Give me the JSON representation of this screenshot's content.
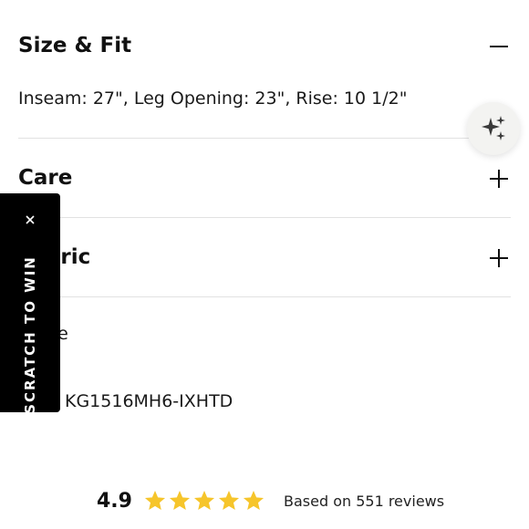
{
  "sections": {
    "size_fit": {
      "title": "Size & Fit",
      "details": "Inseam: 27\", Leg Opening: 23\", Rise: 10 1/2\""
    },
    "care": {
      "title": "Care"
    },
    "fabric": {
      "title": "Fabric"
    }
  },
  "share": {
    "label": "Share"
  },
  "sku": {
    "value": "KG1516MH6-IXHTD"
  },
  "scratch_tab": {
    "label": "SCRATCH TO WIN"
  },
  "reviews": {
    "rating": "4.9",
    "stars": 5,
    "summary": "Based on 551 reviews"
  },
  "colors": {
    "star": "#F6C52B",
    "tab_bg": "#000000",
    "text": "#111111"
  },
  "icons": [
    "minus-icon",
    "plus-icon",
    "sparkles-icon",
    "close-icon",
    "star-icon"
  ]
}
